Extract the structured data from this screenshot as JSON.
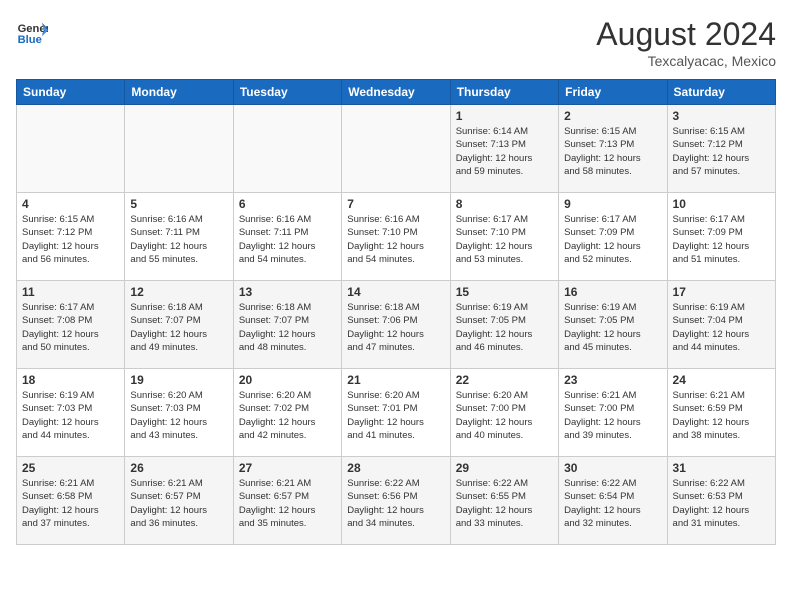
{
  "header": {
    "logo_line1": "General",
    "logo_line2": "Blue",
    "month_title": "August 2024",
    "location": "Texcalyacac, Mexico"
  },
  "weekdays": [
    "Sunday",
    "Monday",
    "Tuesday",
    "Wednesday",
    "Thursday",
    "Friday",
    "Saturday"
  ],
  "weeks": [
    [
      {
        "day": "",
        "info": ""
      },
      {
        "day": "",
        "info": ""
      },
      {
        "day": "",
        "info": ""
      },
      {
        "day": "",
        "info": ""
      },
      {
        "day": "1",
        "info": "Sunrise: 6:14 AM\nSunset: 7:13 PM\nDaylight: 12 hours\nand 59 minutes."
      },
      {
        "day": "2",
        "info": "Sunrise: 6:15 AM\nSunset: 7:13 PM\nDaylight: 12 hours\nand 58 minutes."
      },
      {
        "day": "3",
        "info": "Sunrise: 6:15 AM\nSunset: 7:12 PM\nDaylight: 12 hours\nand 57 minutes."
      }
    ],
    [
      {
        "day": "4",
        "info": "Sunrise: 6:15 AM\nSunset: 7:12 PM\nDaylight: 12 hours\nand 56 minutes."
      },
      {
        "day": "5",
        "info": "Sunrise: 6:16 AM\nSunset: 7:11 PM\nDaylight: 12 hours\nand 55 minutes."
      },
      {
        "day": "6",
        "info": "Sunrise: 6:16 AM\nSunset: 7:11 PM\nDaylight: 12 hours\nand 54 minutes."
      },
      {
        "day": "7",
        "info": "Sunrise: 6:16 AM\nSunset: 7:10 PM\nDaylight: 12 hours\nand 54 minutes."
      },
      {
        "day": "8",
        "info": "Sunrise: 6:17 AM\nSunset: 7:10 PM\nDaylight: 12 hours\nand 53 minutes."
      },
      {
        "day": "9",
        "info": "Sunrise: 6:17 AM\nSunset: 7:09 PM\nDaylight: 12 hours\nand 52 minutes."
      },
      {
        "day": "10",
        "info": "Sunrise: 6:17 AM\nSunset: 7:09 PM\nDaylight: 12 hours\nand 51 minutes."
      }
    ],
    [
      {
        "day": "11",
        "info": "Sunrise: 6:17 AM\nSunset: 7:08 PM\nDaylight: 12 hours\nand 50 minutes."
      },
      {
        "day": "12",
        "info": "Sunrise: 6:18 AM\nSunset: 7:07 PM\nDaylight: 12 hours\nand 49 minutes."
      },
      {
        "day": "13",
        "info": "Sunrise: 6:18 AM\nSunset: 7:07 PM\nDaylight: 12 hours\nand 48 minutes."
      },
      {
        "day": "14",
        "info": "Sunrise: 6:18 AM\nSunset: 7:06 PM\nDaylight: 12 hours\nand 47 minutes."
      },
      {
        "day": "15",
        "info": "Sunrise: 6:19 AM\nSunset: 7:05 PM\nDaylight: 12 hours\nand 46 minutes."
      },
      {
        "day": "16",
        "info": "Sunrise: 6:19 AM\nSunset: 7:05 PM\nDaylight: 12 hours\nand 45 minutes."
      },
      {
        "day": "17",
        "info": "Sunrise: 6:19 AM\nSunset: 7:04 PM\nDaylight: 12 hours\nand 44 minutes."
      }
    ],
    [
      {
        "day": "18",
        "info": "Sunrise: 6:19 AM\nSunset: 7:03 PM\nDaylight: 12 hours\nand 44 minutes."
      },
      {
        "day": "19",
        "info": "Sunrise: 6:20 AM\nSunset: 7:03 PM\nDaylight: 12 hours\nand 43 minutes."
      },
      {
        "day": "20",
        "info": "Sunrise: 6:20 AM\nSunset: 7:02 PM\nDaylight: 12 hours\nand 42 minutes."
      },
      {
        "day": "21",
        "info": "Sunrise: 6:20 AM\nSunset: 7:01 PM\nDaylight: 12 hours\nand 41 minutes."
      },
      {
        "day": "22",
        "info": "Sunrise: 6:20 AM\nSunset: 7:00 PM\nDaylight: 12 hours\nand 40 minutes."
      },
      {
        "day": "23",
        "info": "Sunrise: 6:21 AM\nSunset: 7:00 PM\nDaylight: 12 hours\nand 39 minutes."
      },
      {
        "day": "24",
        "info": "Sunrise: 6:21 AM\nSunset: 6:59 PM\nDaylight: 12 hours\nand 38 minutes."
      }
    ],
    [
      {
        "day": "25",
        "info": "Sunrise: 6:21 AM\nSunset: 6:58 PM\nDaylight: 12 hours\nand 37 minutes."
      },
      {
        "day": "26",
        "info": "Sunrise: 6:21 AM\nSunset: 6:57 PM\nDaylight: 12 hours\nand 36 minutes."
      },
      {
        "day": "27",
        "info": "Sunrise: 6:21 AM\nSunset: 6:57 PM\nDaylight: 12 hours\nand 35 minutes."
      },
      {
        "day": "28",
        "info": "Sunrise: 6:22 AM\nSunset: 6:56 PM\nDaylight: 12 hours\nand 34 minutes."
      },
      {
        "day": "29",
        "info": "Sunrise: 6:22 AM\nSunset: 6:55 PM\nDaylight: 12 hours\nand 33 minutes."
      },
      {
        "day": "30",
        "info": "Sunrise: 6:22 AM\nSunset: 6:54 PM\nDaylight: 12 hours\nand 32 minutes."
      },
      {
        "day": "31",
        "info": "Sunrise: 6:22 AM\nSunset: 6:53 PM\nDaylight: 12 hours\nand 31 minutes."
      }
    ]
  ]
}
